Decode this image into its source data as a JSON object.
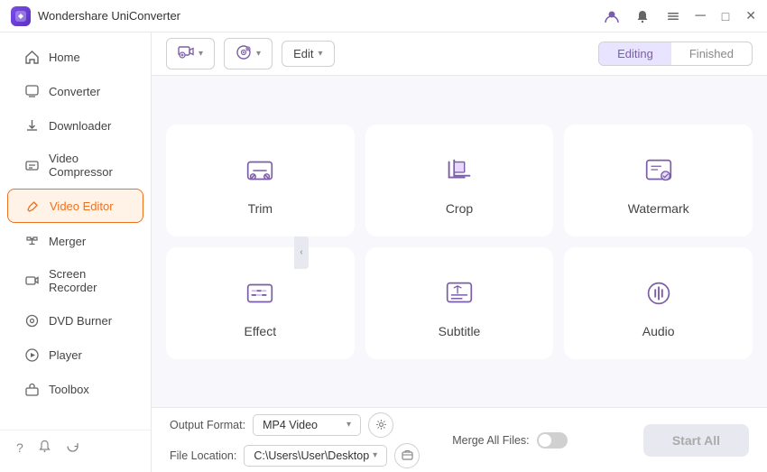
{
  "titleBar": {
    "appName": "Wondershare UniConverter",
    "controls": {
      "profile": "👤",
      "bell": "🔔",
      "menu": "☰",
      "minimize": "─",
      "maximize": "□",
      "close": "✕"
    }
  },
  "sidebar": {
    "items": [
      {
        "id": "home",
        "label": "Home",
        "icon": "home"
      },
      {
        "id": "converter",
        "label": "Converter",
        "icon": "converter"
      },
      {
        "id": "downloader",
        "label": "Downloader",
        "icon": "downloader"
      },
      {
        "id": "video-compressor",
        "label": "Video Compressor",
        "icon": "compress"
      },
      {
        "id": "video-editor",
        "label": "Video Editor",
        "icon": "edit",
        "active": true
      },
      {
        "id": "merger",
        "label": "Merger",
        "icon": "merge"
      },
      {
        "id": "screen-recorder",
        "label": "Screen Recorder",
        "icon": "record"
      },
      {
        "id": "dvd-burner",
        "label": "DVD Burner",
        "icon": "dvd"
      },
      {
        "id": "player",
        "label": "Player",
        "icon": "player"
      },
      {
        "id": "toolbox",
        "label": "Toolbox",
        "icon": "toolbox"
      }
    ],
    "bottomIcons": [
      "?",
      "🔔",
      "↺"
    ]
  },
  "toolbar": {
    "addVideoLabel": "+",
    "addMediaLabel": "+",
    "editDropdownLabel": "Edit",
    "tabs": [
      {
        "id": "editing",
        "label": "Editing",
        "active": true
      },
      {
        "id": "finished",
        "label": "Finished",
        "active": false
      }
    ]
  },
  "tools": [
    {
      "id": "trim",
      "label": "Trim"
    },
    {
      "id": "crop",
      "label": "Crop"
    },
    {
      "id": "watermark",
      "label": "Watermark"
    },
    {
      "id": "effect",
      "label": "Effect"
    },
    {
      "id": "subtitle",
      "label": "Subtitle"
    },
    {
      "id": "audio",
      "label": "Audio"
    }
  ],
  "footer": {
    "outputFormatLabel": "Output Format:",
    "outputFormatValue": "MP4 Video",
    "fileLocationLabel": "File Location:",
    "fileLocationValue": "C:\\Users\\User\\Desktop",
    "mergeAllLabel": "Merge All Files:",
    "startAllLabel": "Start All"
  }
}
